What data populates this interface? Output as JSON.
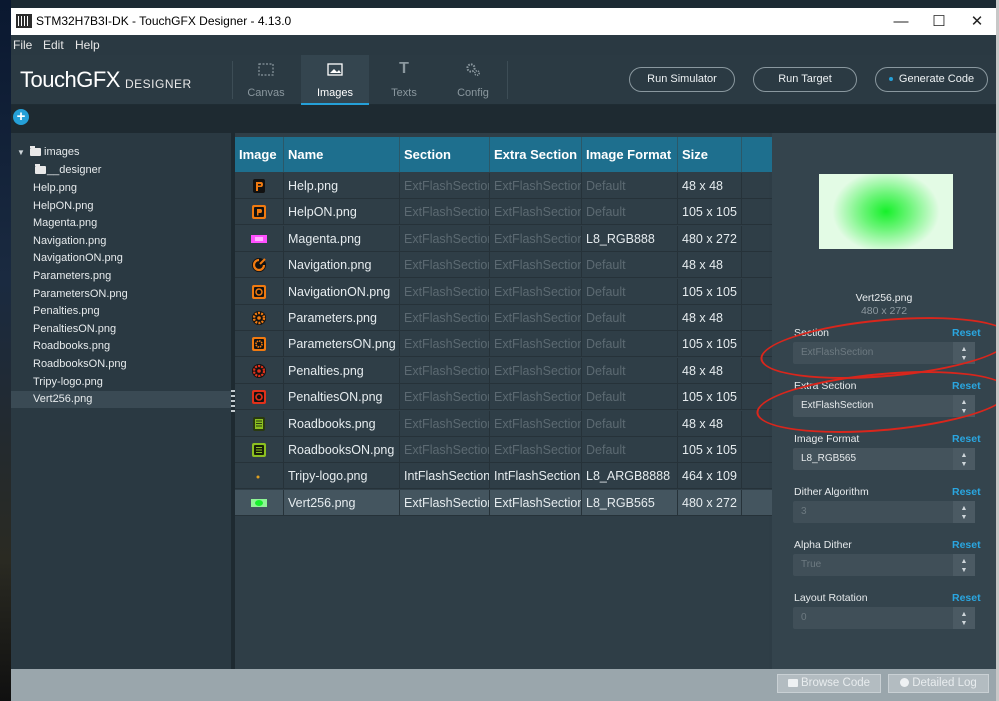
{
  "window": {
    "title": "STM32H7B3I-DK - TouchGFX Designer - 4.13.0",
    "controls": {
      "minimize": "—",
      "maximize": "☐",
      "close": "✕"
    }
  },
  "menu": [
    "File",
    "Edit",
    "Help"
  ],
  "header": {
    "logo": "TouchGFX",
    "logo_sub": "DESIGNER",
    "tabs": [
      {
        "label": "Canvas",
        "icon": "canvas-icon"
      },
      {
        "label": "Images",
        "icon": "images-icon",
        "active": true
      },
      {
        "label": "Texts",
        "icon": "texts-icon",
        "glyph": "T"
      },
      {
        "label": "Config",
        "icon": "config-icon"
      }
    ],
    "buttons": {
      "run_simulator": "Run Simulator",
      "run_target": "Run Target",
      "generate_code": "Generate Code"
    }
  },
  "toolbar": {
    "add": "+"
  },
  "tree": {
    "root": "images",
    "subfolder": "__designer",
    "files": [
      "Help.png",
      "HelpON.png",
      "Magenta.png",
      "Navigation.png",
      "NavigationON.png",
      "Parameters.png",
      "ParametersON.png",
      "Penalties.png",
      "PenaltiesON.png",
      "Roadbooks.png",
      "RoadbooksON.png",
      "Tripy-logo.png",
      "Vert256.png"
    ],
    "selected": "Vert256.png"
  },
  "table": {
    "columns": [
      "Image",
      "Name",
      "Section",
      "Extra Section",
      "Image Format",
      "Size"
    ],
    "rows": [
      {
        "name": "Help.png",
        "section": "ExtFlashSection",
        "extra": "ExtFlashSection",
        "format": "Default",
        "size": "48 x 48",
        "thumb": "help"
      },
      {
        "name": "HelpON.png",
        "section": "ExtFlashSection",
        "extra": "ExtFlashSection",
        "format": "Default",
        "size": "105 x 105",
        "thumb": "help-on"
      },
      {
        "name": "Magenta.png",
        "section": "ExtFlashSection",
        "extra": "ExtFlashSection",
        "format": "L8_RGB888",
        "size": "480 x 272",
        "thumb": "magenta"
      },
      {
        "name": "Navigation.png",
        "section": "ExtFlashSection",
        "extra": "ExtFlashSection",
        "format": "Default",
        "size": "48 x 48",
        "thumb": "nav"
      },
      {
        "name": "NavigationON.png",
        "section": "ExtFlashSection",
        "extra": "ExtFlashSection",
        "format": "Default",
        "size": "105 x 105",
        "thumb": "nav-on"
      },
      {
        "name": "Parameters.png",
        "section": "ExtFlashSection",
        "extra": "ExtFlashSection",
        "format": "Default",
        "size": "48 x 48",
        "thumb": "params"
      },
      {
        "name": "ParametersON.png",
        "section": "ExtFlashSection",
        "extra": "ExtFlashSection",
        "format": "Default",
        "size": "105 x 105",
        "thumb": "params-on"
      },
      {
        "name": "Penalties.png",
        "section": "ExtFlashSection",
        "extra": "ExtFlashSection",
        "format": "Default",
        "size": "48 x 48",
        "thumb": "pen"
      },
      {
        "name": "PenaltiesON.png",
        "section": "ExtFlashSection",
        "extra": "ExtFlashSection",
        "format": "Default",
        "size": "105 x 105",
        "thumb": "pen-on"
      },
      {
        "name": "Roadbooks.png",
        "section": "ExtFlashSection",
        "extra": "ExtFlashSection",
        "format": "Default",
        "size": "48 x 48",
        "thumb": "road"
      },
      {
        "name": "RoadbooksON.png",
        "section": "ExtFlashSection",
        "extra": "ExtFlashSection",
        "format": "Default",
        "size": "105 x 105",
        "thumb": "road-on"
      },
      {
        "name": "Tripy-logo.png",
        "section": "IntFlashSection",
        "extra": "IntFlashSection",
        "format": "L8_ARGB8888",
        "size": "464 x 109",
        "thumb": "logo",
        "bright": true
      },
      {
        "name": "Vert256.png",
        "section": "ExtFlashSection",
        "extra": "ExtFlashSection",
        "format": "L8_RGB565",
        "size": "480 x 272",
        "thumb": "vert",
        "bright": true,
        "selected": true
      }
    ]
  },
  "properties": {
    "preview_name": "Vert256.png",
    "preview_size": "480 x 272",
    "reset": "Reset",
    "fields": [
      {
        "label": "Section",
        "value": "ExtFlashSection",
        "enabled": false
      },
      {
        "label": "Extra Section",
        "value": "ExtFlashSection",
        "enabled": true
      },
      {
        "label": "Image Format",
        "value": "L8_RGB565",
        "enabled": true
      },
      {
        "label": "Dither Algorithm",
        "value": "3",
        "enabled": false
      },
      {
        "label": "Alpha Dither",
        "value": "True",
        "enabled": false
      },
      {
        "label": "Layout Rotation",
        "value": "0",
        "enabled": false
      }
    ],
    "colors": {
      "reset": "#2aa6e0",
      "annotation": "#d9261c"
    }
  },
  "statusbar": {
    "browse_code": "Browse Code",
    "detailed_log": "Detailed Log"
  },
  "colors": {
    "accent": "#25a0d8",
    "table_header": "#1e6f8e",
    "background": "#2e3d46"
  }
}
